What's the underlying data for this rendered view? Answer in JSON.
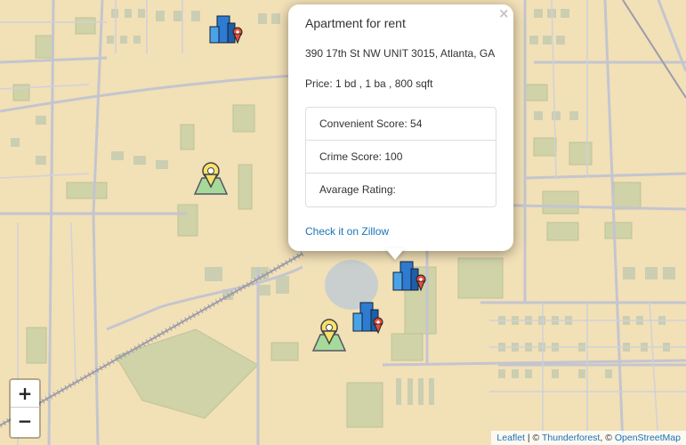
{
  "map": {
    "background_color": "#f3e3bb",
    "markers": [
      {
        "icon": "apartment-building-icon"
      },
      {
        "icon": "apartment-building-icon"
      },
      {
        "icon": "apartment-building-icon"
      },
      {
        "icon": "park-marker-icon"
      },
      {
        "icon": "park-marker-icon"
      }
    ]
  },
  "popup": {
    "title": "Apartment for rent",
    "address": "390 17th St NW UNIT 3015, Atlanta, GA",
    "price": "Price: 1 bd , 1 ba , 800 sqft",
    "convenient_score": "Convenient Score: 54",
    "crime_score": "Crime Score: 100",
    "average_rating": "Avarage Rating:",
    "link_text": "Check it on Zillow",
    "close_glyph": "×",
    "link_color": "#1a73b8"
  },
  "zoom": {
    "in_label": "+",
    "out_label": "−"
  },
  "attribution": {
    "leaflet": "Leaflet",
    "sep1": " | © ",
    "thunderforest": "Thunderforest",
    "sep2": ", © ",
    "osm": "OpenStreetMap"
  }
}
